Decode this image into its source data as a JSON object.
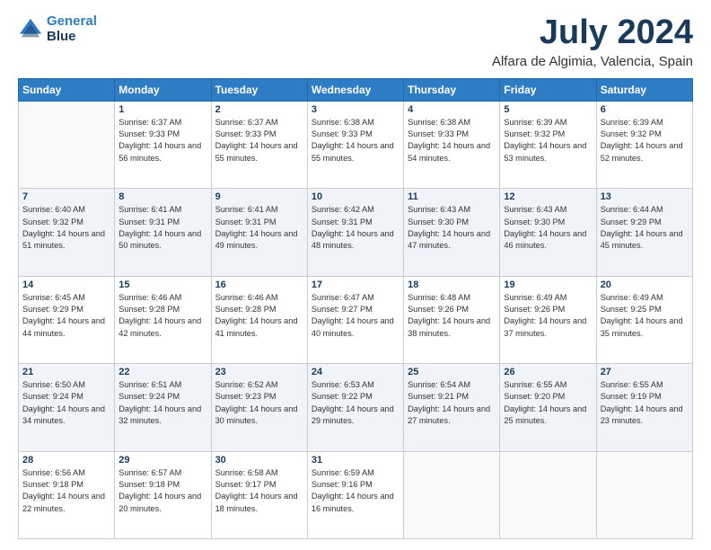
{
  "logo": {
    "line1": "General",
    "line2": "Blue"
  },
  "title": "July 2024",
  "subtitle": "Alfara de Algimia, Valencia, Spain",
  "weekdays": [
    "Sunday",
    "Monday",
    "Tuesday",
    "Wednesday",
    "Thursday",
    "Friday",
    "Saturday"
  ],
  "weeks": [
    [
      {
        "day": "",
        "empty": true
      },
      {
        "day": "1",
        "sunrise": "Sunrise: 6:37 AM",
        "sunset": "Sunset: 9:33 PM",
        "daylight": "Daylight: 14 hours and 56 minutes."
      },
      {
        "day": "2",
        "sunrise": "Sunrise: 6:37 AM",
        "sunset": "Sunset: 9:33 PM",
        "daylight": "Daylight: 14 hours and 55 minutes."
      },
      {
        "day": "3",
        "sunrise": "Sunrise: 6:38 AM",
        "sunset": "Sunset: 9:33 PM",
        "daylight": "Daylight: 14 hours and 55 minutes."
      },
      {
        "day": "4",
        "sunrise": "Sunrise: 6:38 AM",
        "sunset": "Sunset: 9:33 PM",
        "daylight": "Daylight: 14 hours and 54 minutes."
      },
      {
        "day": "5",
        "sunrise": "Sunrise: 6:39 AM",
        "sunset": "Sunset: 9:32 PM",
        "daylight": "Daylight: 14 hours and 53 minutes."
      },
      {
        "day": "6",
        "sunrise": "Sunrise: 6:39 AM",
        "sunset": "Sunset: 9:32 PM",
        "daylight": "Daylight: 14 hours and 52 minutes."
      }
    ],
    [
      {
        "day": "7",
        "sunrise": "Sunrise: 6:40 AM",
        "sunset": "Sunset: 9:32 PM",
        "daylight": "Daylight: 14 hours and 51 minutes."
      },
      {
        "day": "8",
        "sunrise": "Sunrise: 6:41 AM",
        "sunset": "Sunset: 9:31 PM",
        "daylight": "Daylight: 14 hours and 50 minutes."
      },
      {
        "day": "9",
        "sunrise": "Sunrise: 6:41 AM",
        "sunset": "Sunset: 9:31 PM",
        "daylight": "Daylight: 14 hours and 49 minutes."
      },
      {
        "day": "10",
        "sunrise": "Sunrise: 6:42 AM",
        "sunset": "Sunset: 9:31 PM",
        "daylight": "Daylight: 14 hours and 48 minutes."
      },
      {
        "day": "11",
        "sunrise": "Sunrise: 6:43 AM",
        "sunset": "Sunset: 9:30 PM",
        "daylight": "Daylight: 14 hours and 47 minutes."
      },
      {
        "day": "12",
        "sunrise": "Sunrise: 6:43 AM",
        "sunset": "Sunset: 9:30 PM",
        "daylight": "Daylight: 14 hours and 46 minutes."
      },
      {
        "day": "13",
        "sunrise": "Sunrise: 6:44 AM",
        "sunset": "Sunset: 9:29 PM",
        "daylight": "Daylight: 14 hours and 45 minutes."
      }
    ],
    [
      {
        "day": "14",
        "sunrise": "Sunrise: 6:45 AM",
        "sunset": "Sunset: 9:29 PM",
        "daylight": "Daylight: 14 hours and 44 minutes."
      },
      {
        "day": "15",
        "sunrise": "Sunrise: 6:46 AM",
        "sunset": "Sunset: 9:28 PM",
        "daylight": "Daylight: 14 hours and 42 minutes."
      },
      {
        "day": "16",
        "sunrise": "Sunrise: 6:46 AM",
        "sunset": "Sunset: 9:28 PM",
        "daylight": "Daylight: 14 hours and 41 minutes."
      },
      {
        "day": "17",
        "sunrise": "Sunrise: 6:47 AM",
        "sunset": "Sunset: 9:27 PM",
        "daylight": "Daylight: 14 hours and 40 minutes."
      },
      {
        "day": "18",
        "sunrise": "Sunrise: 6:48 AM",
        "sunset": "Sunset: 9:26 PM",
        "daylight": "Daylight: 14 hours and 38 minutes."
      },
      {
        "day": "19",
        "sunrise": "Sunrise: 6:49 AM",
        "sunset": "Sunset: 9:26 PM",
        "daylight": "Daylight: 14 hours and 37 minutes."
      },
      {
        "day": "20",
        "sunrise": "Sunrise: 6:49 AM",
        "sunset": "Sunset: 9:25 PM",
        "daylight": "Daylight: 14 hours and 35 minutes."
      }
    ],
    [
      {
        "day": "21",
        "sunrise": "Sunrise: 6:50 AM",
        "sunset": "Sunset: 9:24 PM",
        "daylight": "Daylight: 14 hours and 34 minutes."
      },
      {
        "day": "22",
        "sunrise": "Sunrise: 6:51 AM",
        "sunset": "Sunset: 9:24 PM",
        "daylight": "Daylight: 14 hours and 32 minutes."
      },
      {
        "day": "23",
        "sunrise": "Sunrise: 6:52 AM",
        "sunset": "Sunset: 9:23 PM",
        "daylight": "Daylight: 14 hours and 30 minutes."
      },
      {
        "day": "24",
        "sunrise": "Sunrise: 6:53 AM",
        "sunset": "Sunset: 9:22 PM",
        "daylight": "Daylight: 14 hours and 29 minutes."
      },
      {
        "day": "25",
        "sunrise": "Sunrise: 6:54 AM",
        "sunset": "Sunset: 9:21 PM",
        "daylight": "Daylight: 14 hours and 27 minutes."
      },
      {
        "day": "26",
        "sunrise": "Sunrise: 6:55 AM",
        "sunset": "Sunset: 9:20 PM",
        "daylight": "Daylight: 14 hours and 25 minutes."
      },
      {
        "day": "27",
        "sunrise": "Sunrise: 6:55 AM",
        "sunset": "Sunset: 9:19 PM",
        "daylight": "Daylight: 14 hours and 23 minutes."
      }
    ],
    [
      {
        "day": "28",
        "sunrise": "Sunrise: 6:56 AM",
        "sunset": "Sunset: 9:18 PM",
        "daylight": "Daylight: 14 hours and 22 minutes."
      },
      {
        "day": "29",
        "sunrise": "Sunrise: 6:57 AM",
        "sunset": "Sunset: 9:18 PM",
        "daylight": "Daylight: 14 hours and 20 minutes."
      },
      {
        "day": "30",
        "sunrise": "Sunrise: 6:58 AM",
        "sunset": "Sunset: 9:17 PM",
        "daylight": "Daylight: 14 hours and 18 minutes."
      },
      {
        "day": "31",
        "sunrise": "Sunrise: 6:59 AM",
        "sunset": "Sunset: 9:16 PM",
        "daylight": "Daylight: 14 hours and 16 minutes."
      },
      {
        "day": "",
        "empty": true
      },
      {
        "day": "",
        "empty": true
      },
      {
        "day": "",
        "empty": true
      }
    ]
  ]
}
